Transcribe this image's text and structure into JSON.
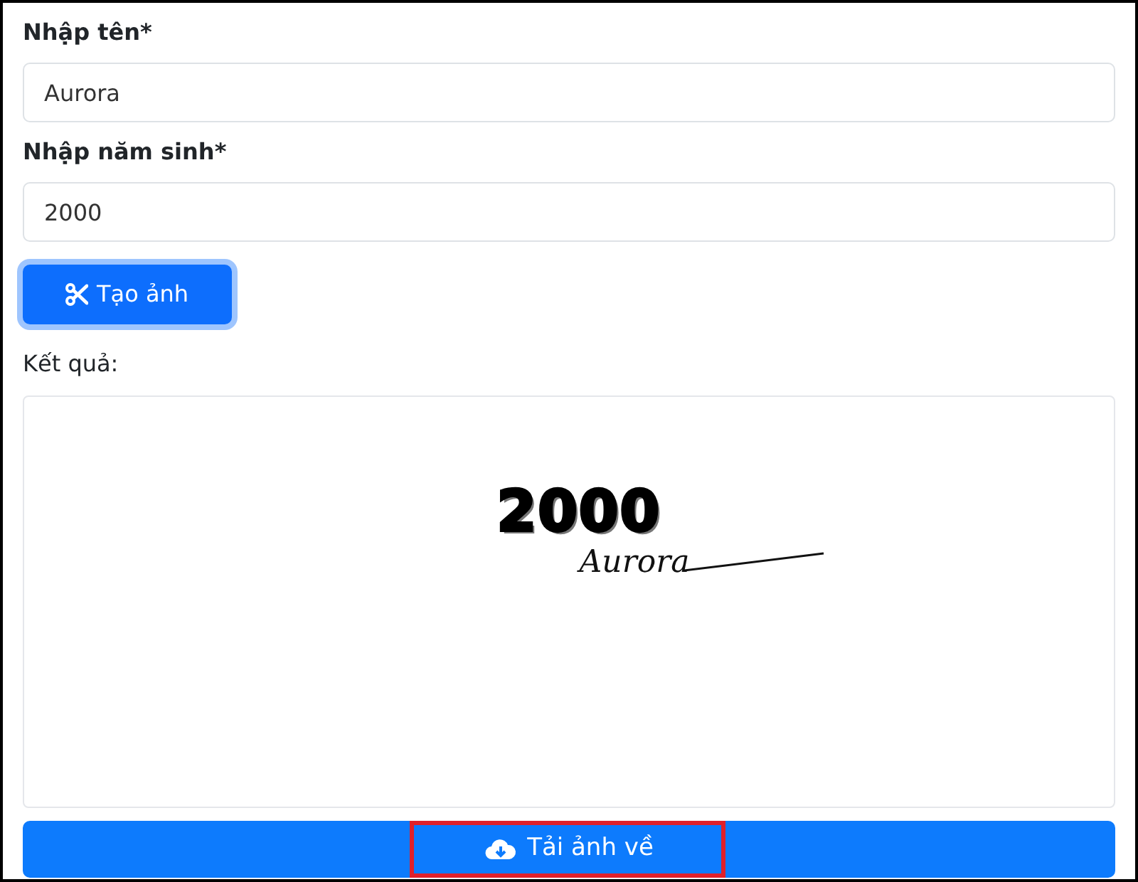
{
  "form": {
    "fields": [
      {
        "label": "Nhập tên*",
        "value": "Aurora"
      },
      {
        "label": "Nhập năm sinh*",
        "value": "2000"
      }
    ],
    "create_button": {
      "label": "Tạo ảnh",
      "focused": true
    }
  },
  "result": {
    "label": "Kết quả:",
    "image": {
      "year": "2000",
      "signature": "Aurora"
    }
  },
  "download_button": {
    "label": "Tải ảnh về",
    "highlighted": true
  }
}
